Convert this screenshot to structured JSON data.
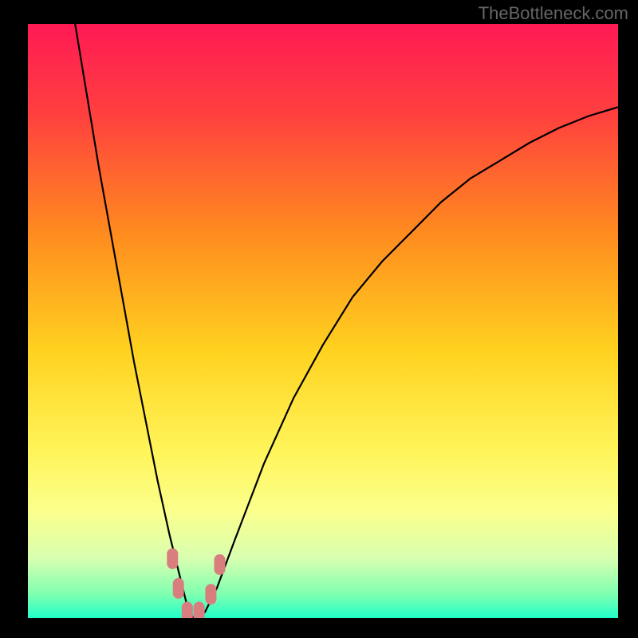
{
  "watermark": "TheBottleneck.com",
  "chart_data": {
    "type": "line",
    "title": "",
    "xlabel": "",
    "ylabel": "",
    "xlim": [
      0,
      100
    ],
    "ylim": [
      0,
      100
    ],
    "background": {
      "type": "vertical-gradient",
      "stops": [
        {
          "pos": 0.0,
          "color": "#ff1a55"
        },
        {
          "pos": 0.15,
          "color": "#ff3f3f"
        },
        {
          "pos": 0.35,
          "color": "#ff8a1f"
        },
        {
          "pos": 0.55,
          "color": "#ffd21f"
        },
        {
          "pos": 0.72,
          "color": "#fff55a"
        },
        {
          "pos": 0.82,
          "color": "#fbff8c"
        },
        {
          "pos": 0.9,
          "color": "#d8ffb0"
        },
        {
          "pos": 0.96,
          "color": "#7fffb0"
        },
        {
          "pos": 1.0,
          "color": "#1fffc9"
        }
      ]
    },
    "series": [
      {
        "name": "bottleneck-curve",
        "color": "#000000",
        "x": [
          8,
          10,
          12,
          14,
          16,
          18,
          20,
          22,
          24,
          26,
          27,
          28,
          30,
          32,
          35,
          40,
          45,
          50,
          55,
          60,
          65,
          70,
          75,
          80,
          85,
          90,
          95,
          100
        ],
        "y": [
          100,
          88,
          76,
          65,
          54,
          43,
          33,
          23,
          14,
          6,
          2,
          0,
          1,
          5,
          13,
          26,
          37,
          46,
          54,
          60,
          65,
          70,
          74,
          77,
          80,
          82.5,
          84.5,
          86
        ]
      }
    ],
    "markers": [
      {
        "name": "marker-left-1",
        "x": 24.5,
        "y": 10,
        "color": "#d97e7e"
      },
      {
        "name": "marker-left-2",
        "x": 25.5,
        "y": 5,
        "color": "#d97e7e"
      },
      {
        "name": "marker-bottom-1",
        "x": 27,
        "y": 1,
        "color": "#d97e7e"
      },
      {
        "name": "marker-bottom-2",
        "x": 29,
        "y": 1,
        "color": "#d97e7e"
      },
      {
        "name": "marker-right-1",
        "x": 31,
        "y": 4,
        "color": "#d97e7e"
      },
      {
        "name": "marker-right-2",
        "x": 32.5,
        "y": 9,
        "color": "#d97e7e"
      }
    ]
  }
}
